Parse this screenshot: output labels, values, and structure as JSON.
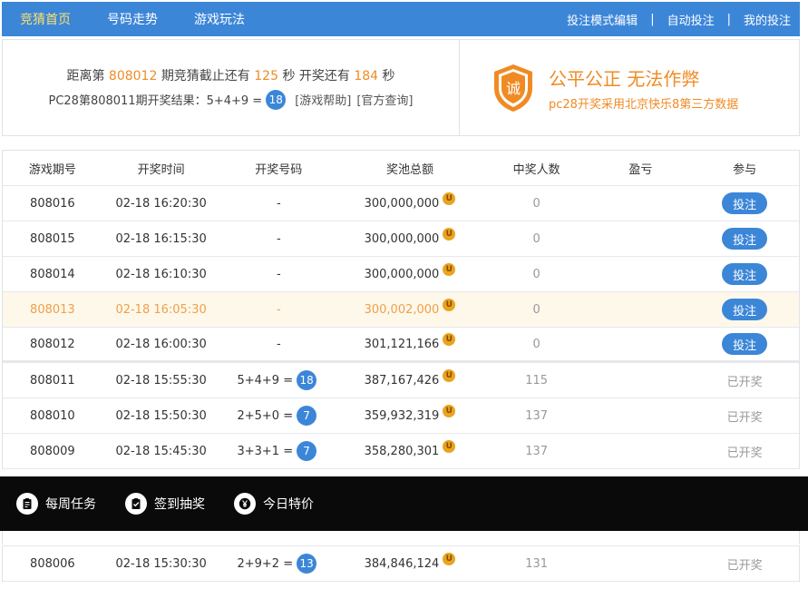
{
  "nav": {
    "items": [
      "竞猜首页",
      "号码走势",
      "游戏玩法"
    ],
    "right": [
      "投注模式编辑",
      "自动投注",
      "我的投注"
    ],
    "separator": "|"
  },
  "info": {
    "prefix": "距离第",
    "next_period": "808012",
    "mid1": "期竞猜截止还有",
    "countdown_close": "125",
    "mid2": "秒 开奖还有",
    "countdown_draw": "184",
    "suffix": "秒",
    "result_prefix": "PC28第808011期开奖结果：5+4+9 =",
    "result_value": "18",
    "help_link": "[游戏帮助]",
    "official_link": "[官方查询]",
    "shield_char": "诚",
    "slogan_title": "公平公正 无法作弊",
    "slogan_sub": "pc28开奖采用北京快乐8第三方数据"
  },
  "table": {
    "headers": [
      "游戏期号",
      "开奖时间",
      "开奖号码",
      "奖池总额",
      "中奖人数",
      "盈亏",
      "参与"
    ],
    "coin_char": "U",
    "bet_label": "投注",
    "done_label": "已开奖",
    "upcoming": [
      {
        "period": "808016",
        "time": "02-18 16:20:30",
        "result": "-",
        "pool": "300,000,000",
        "winners": "0"
      },
      {
        "period": "808015",
        "time": "02-18 16:15:30",
        "result": "-",
        "pool": "300,000,000",
        "winners": "0"
      },
      {
        "period": "808014",
        "time": "02-18 16:10:30",
        "result": "-",
        "pool": "300,000,000",
        "winners": "0"
      },
      {
        "period": "808013",
        "time": "02-18 16:05:30",
        "result": "-",
        "pool": "300,002,000",
        "winners": "0"
      },
      {
        "period": "808012",
        "time": "02-18 16:00:30",
        "result": "-",
        "pool": "301,121,166",
        "winners": "0"
      }
    ],
    "finished": [
      {
        "period": "808011",
        "time": "02-18 15:55:30",
        "expr": "5+4+9 =",
        "sum": "18",
        "pool": "387,167,426",
        "winners": "115"
      },
      {
        "period": "808010",
        "time": "02-18 15:50:30",
        "expr": "2+5+0 =",
        "sum": "7",
        "pool": "359,932,319",
        "winners": "137"
      },
      {
        "period": "808009",
        "time": "02-18 15:45:30",
        "expr": "3+3+1 =",
        "sum": "7",
        "pool": "358,280,301",
        "winners": "137"
      }
    ],
    "after_overlay": [
      {
        "period": "808006",
        "time": "02-18 15:30:30",
        "expr": "2+9+2 =",
        "sum": "13",
        "pool": "384,846,124",
        "winners": "131"
      }
    ]
  },
  "overlay": {
    "items": [
      "每周任务",
      "签到抽奖",
      "今日特价"
    ]
  },
  "colors": {
    "brand": "#3c86d8",
    "accent": "#f08b24",
    "highlight_row": "#fdf8ea"
  }
}
